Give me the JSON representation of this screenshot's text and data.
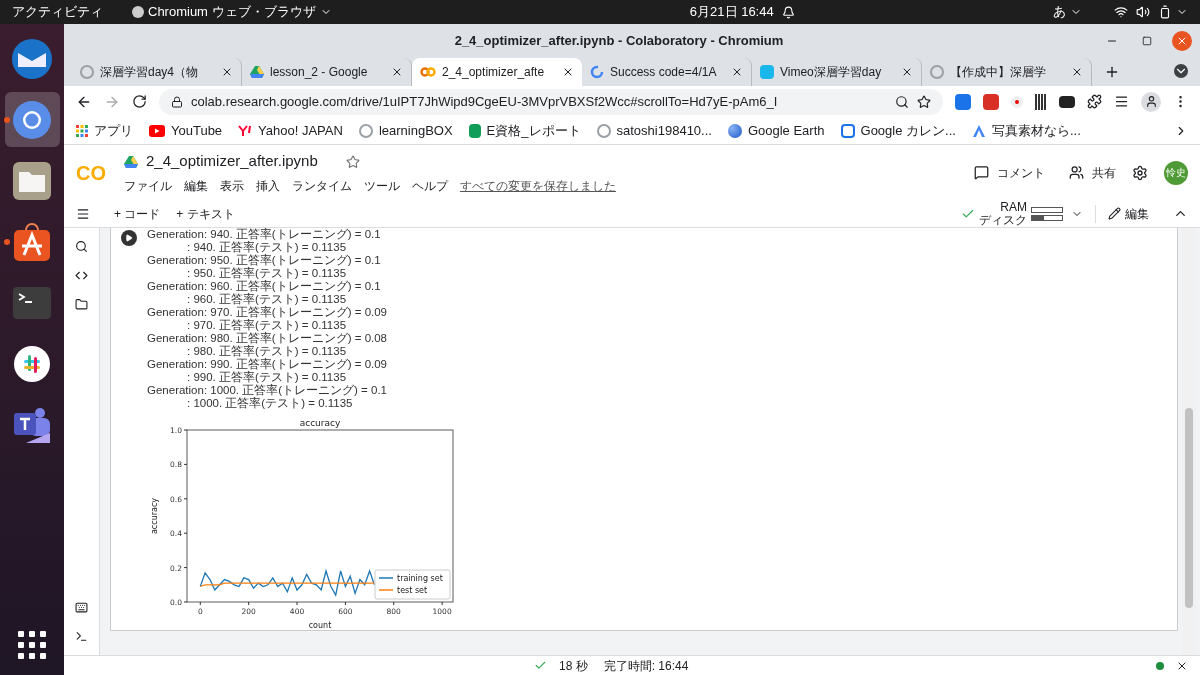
{
  "topbar": {
    "activities": "アクティビティ",
    "app_menu": "Chromium ウェブ・ブラウザ",
    "clock": "6月21日  16:44",
    "input_method": "あ"
  },
  "dock": [
    {
      "kind": "mail",
      "running": false,
      "selected": false
    },
    {
      "kind": "browser",
      "running": true,
      "selected": true
    },
    {
      "kind": "files",
      "running": false,
      "selected": false
    },
    {
      "kind": "store",
      "running": true,
      "selected": false
    },
    {
      "kind": "terminal",
      "running": false,
      "selected": false
    },
    {
      "kind": "slack",
      "running": false,
      "selected": false
    },
    {
      "kind": "teams",
      "running": false,
      "selected": false
    }
  ],
  "window": {
    "title": "2_4_optimizer_after.ipynb - Colaboratory - Chromium"
  },
  "tabs": [
    {
      "label": "深層学習day4（物",
      "kind": "generic",
      "selected": false
    },
    {
      "label": "lesson_2 - Google",
      "kind": "drive",
      "selected": false
    },
    {
      "label": "2_4_optimizer_afte",
      "kind": "colab",
      "selected": true
    },
    {
      "label": "Success code=4/1A",
      "kind": "google",
      "selected": false
    },
    {
      "label": "Vimeo深層学習day",
      "kind": "vimeo",
      "selected": false
    },
    {
      "label": "【作成中】深層学",
      "kind": "generic",
      "selected": false
    }
  ],
  "address": {
    "url": "colab.research.google.com/drive/1uIPT7JhWipd9CgeEU-3MVprVBXSf2Wcc#scrollTo=Hd7yE-pAm6_I"
  },
  "bookmarks": [
    {
      "label": "アプリ",
      "kind": "apps"
    },
    {
      "label": "YouTube",
      "kind": "youtube"
    },
    {
      "label": "Yahoo! JAPAN",
      "kind": "yahoo"
    },
    {
      "label": "learningBOX",
      "kind": "generic"
    },
    {
      "label": "E資格_レポート",
      "kind": "sheets"
    },
    {
      "label": "satoshi198410...",
      "kind": "generic"
    },
    {
      "label": "Google Earth",
      "kind": "earth"
    },
    {
      "label": "Google カレン...",
      "kind": "calendar"
    },
    {
      "label": "写真素材なら...",
      "kind": "triangle"
    }
  ],
  "colab": {
    "logo": "CO",
    "filename": "2_4_optimizer_after.ipynb",
    "menu": [
      "ファイル",
      "編集",
      "表示",
      "挿入",
      "ランタイム",
      "ツール",
      "ヘルプ"
    ],
    "saved": "すべての変更を保存しました",
    "comment": "コメント",
    "share": "共有",
    "avatar": "怜史",
    "add_code": "+ コード",
    "add_text": "+ テキスト",
    "ram": "RAM",
    "disk": "ディスク",
    "edit": "編集"
  },
  "output": [
    {
      "kind": "generation",
      "text": "Generation: 940. 正答率(トレーニング) = 0.1"
    },
    {
      "kind": "test",
      "text": ": 940. 正答率(テスト) = 0.1135"
    },
    {
      "kind": "generation",
      "text": "Generation: 950. 正答率(トレーニング) = 0.1"
    },
    {
      "kind": "test",
      "text": ": 950. 正答率(テスト) = 0.1135"
    },
    {
      "kind": "generation",
      "text": "Generation: 960. 正答率(トレーニング) = 0.1"
    },
    {
      "kind": "test",
      "text": ": 960. 正答率(テスト) = 0.1135"
    },
    {
      "kind": "generation",
      "text": "Generation: 970. 正答率(トレーニング) = 0.09"
    },
    {
      "kind": "test",
      "text": ": 970. 正答率(テスト) = 0.1135"
    },
    {
      "kind": "generation",
      "text": "Generation: 980. 正答率(トレーニング) = 0.08"
    },
    {
      "kind": "test",
      "text": ": 980. 正答率(テスト) = 0.1135"
    },
    {
      "kind": "generation",
      "text": "Generation: 990. 正答率(トレーニング) = 0.09"
    },
    {
      "kind": "test",
      "text": ": 990. 正答率(テスト) = 0.1135"
    },
    {
      "kind": "generation",
      "text": "Generation: 1000. 正答率(トレーニング) = 0.1"
    },
    {
      "kind": "test",
      "text": ": 1000. 正答率(テスト) = 0.1135"
    }
  ],
  "chart_data": {
    "type": "line",
    "title": "accuracy",
    "xlabel": "count",
    "ylabel": "accuracy",
    "xlim": [
      -55,
      1045
    ],
    "ylim": [
      0,
      1
    ],
    "xticks": [
      0,
      200,
      400,
      600,
      800,
      1000
    ],
    "yticks": [
      {
        "value": 0,
        "label": "0.0"
      },
      {
        "value": 0.2,
        "label": "0.2"
      },
      {
        "value": 0.4,
        "label": "0.4"
      },
      {
        "value": 0.6,
        "label": "0.6"
      },
      {
        "value": 0.8,
        "label": "0.8"
      },
      {
        "value": 1,
        "label": "1.0"
      }
    ],
    "legend": true,
    "x": [
      0,
      20,
      40,
      60,
      80,
      100,
      120,
      140,
      160,
      180,
      200,
      220,
      240,
      260,
      280,
      300,
      320,
      340,
      360,
      380,
      400,
      420,
      440,
      460,
      480,
      500,
      520,
      540,
      560,
      580,
      600,
      620,
      640,
      660,
      680,
      700,
      720
    ],
    "series": [
      {
        "name": "training set",
        "color": "#1f77b4",
        "values": [
          0.09,
          0.17,
          0.13,
          0.07,
          0.1,
          0.13,
          0.12,
          0.1,
          0.09,
          0.14,
          0.13,
          0.08,
          0.11,
          0.09,
          0.1,
          0.14,
          0.09,
          0.11,
          0.06,
          0.14,
          0.07,
          0.1,
          0.16,
          0.11,
          0.1,
          0.07,
          0.18,
          0.09,
          0.04,
          0.18,
          0.09,
          0.15,
          0.05,
          0.13,
          0.1,
          0.18,
          0.1
        ]
      },
      {
        "name": "test set",
        "color": "#ff7f0e",
        "values": [
          0.09,
          0.1,
          0.1,
          0.1,
          0.1,
          0.11,
          0.11,
          0.11,
          0.11,
          0.11,
          0.11,
          0.11,
          0.11,
          0.11,
          0.11,
          0.11,
          0.11,
          0.11,
          0.11,
          0.11,
          0.11,
          0.11,
          0.11,
          0.11,
          0.11,
          0.11,
          0.11,
          0.11,
          0.11,
          0.11,
          0.11,
          0.11,
          0.11,
          0.11,
          0.11,
          0.11,
          0.11
        ]
      }
    ]
  },
  "status_bar": {
    "duration": "18 秒",
    "finished": "完了時間: 16:44",
    "connected": true
  }
}
